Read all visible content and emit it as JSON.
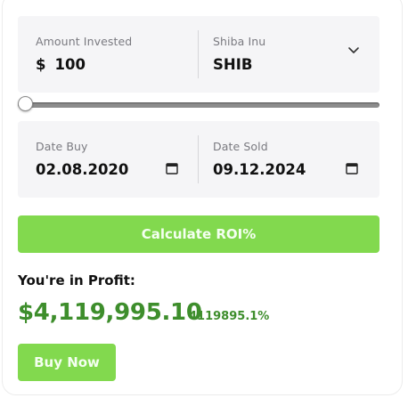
{
  "investment": {
    "amount_label": "Amount Invested",
    "currency_symbol": "$",
    "amount_value": "100",
    "coin_label": "Shiba Inu",
    "coin_symbol": "SHIB",
    "chevron_icon": "chevron-down-icon"
  },
  "slider": {
    "level": 0
  },
  "dates": {
    "buy_label": "Date Buy",
    "buy_value": "02.08.2020",
    "sold_label": "Date Sold",
    "sold_value": "09.12.2024",
    "calendar_icon": "calendar-icon"
  },
  "actions": {
    "calculate_label": "Calculate ROI%",
    "buy_label": "Buy Now"
  },
  "result": {
    "status_label": "You're in Profit:",
    "profit_amount": "$4,119,995.10",
    "profit_percent": "4119895.1%"
  },
  "colors": {
    "accent_green": "#82d94e",
    "profit_green": "#3e8e2c",
    "field_background": "#f5f5f7"
  }
}
